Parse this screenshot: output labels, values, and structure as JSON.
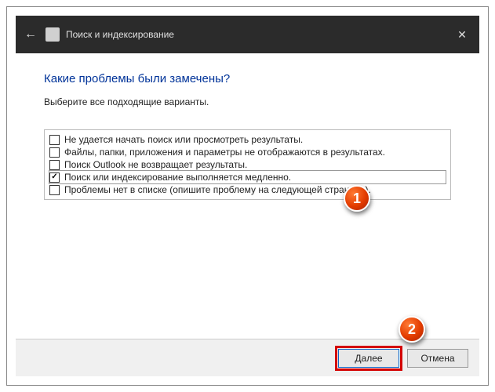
{
  "titlebar": {
    "title": "Поиск и индексирование"
  },
  "heading": "Какие проблемы были замечены?",
  "subtext": "Выберите все подходящие варианты.",
  "options": [
    {
      "label": "Не удается начать поиск или просмотреть результаты.",
      "checked": false
    },
    {
      "label": "Файлы, папки, приложения и параметры не отображаются в результатах.",
      "checked": false
    },
    {
      "label": "Поиск Outlook не возвращает результаты.",
      "checked": false
    },
    {
      "label": "Поиск или индексирование выполняется медленно.",
      "checked": true
    },
    {
      "label": "Проблемы нет в списке (опишите проблему на следующей странице).",
      "checked": false
    }
  ],
  "buttons": {
    "next": "Далее",
    "cancel": "Отмена"
  },
  "markers": {
    "m1": "1",
    "m2": "2"
  }
}
